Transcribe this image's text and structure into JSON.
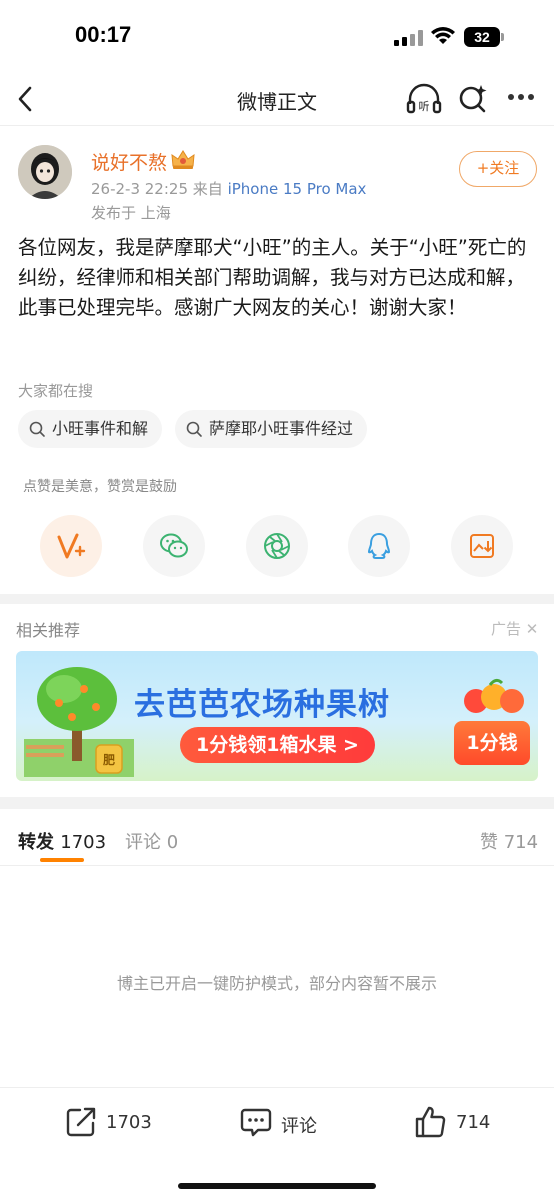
{
  "status_bar": {
    "time": "00:17",
    "battery": "32"
  },
  "nav": {
    "title": "微博正文"
  },
  "post": {
    "username": "说好不熬",
    "meta_time": "26-2-3 22:25",
    "meta_from": "来自",
    "meta_device": "iPhone 15 Pro Max",
    "location": "发布于 上海",
    "follow_label": "+关注",
    "text": "各位网友，我是萨摩耶犬“小旺”的主人。关于“小旺”死亡的纠纷，经律师和相关部门帮助调解，我与对方已达成和解，此事已处理完毕。感谢广大网友的关心！谢谢大家！"
  },
  "hot_search": {
    "label": "大家都在搜",
    "tags": [
      "小旺事件和解",
      "萨摩耶小旺事件经过"
    ]
  },
  "reward_tip": "点赞是美意，赞赏是鼓励",
  "share_icons": [
    "weibo-reward-icon",
    "wechat-icon",
    "moments-icon",
    "qq-icon",
    "save-image-icon"
  ],
  "recommend": {
    "label": "相关推荐",
    "ad_label": "广告",
    "banner_title": "去芭芭农场种果树",
    "banner_cta": "1分钱领1箱水果 >",
    "banner_price": "1分钱",
    "banner_fertilizer": "肥"
  },
  "tabs": {
    "repost_label": "转发",
    "repost_count": "1703",
    "comment_label": "评论",
    "comment_count": "0",
    "like_label": "赞",
    "like_count": "714"
  },
  "protect_notice": "博主已开启一键防护模式，部分内容暂不展示",
  "bottom_bar": {
    "repost": "1703",
    "comment": "评论",
    "like": "714"
  },
  "colors": {
    "accent": "#ff8200",
    "username": "#e8712a",
    "link": "#4a7bc4"
  }
}
